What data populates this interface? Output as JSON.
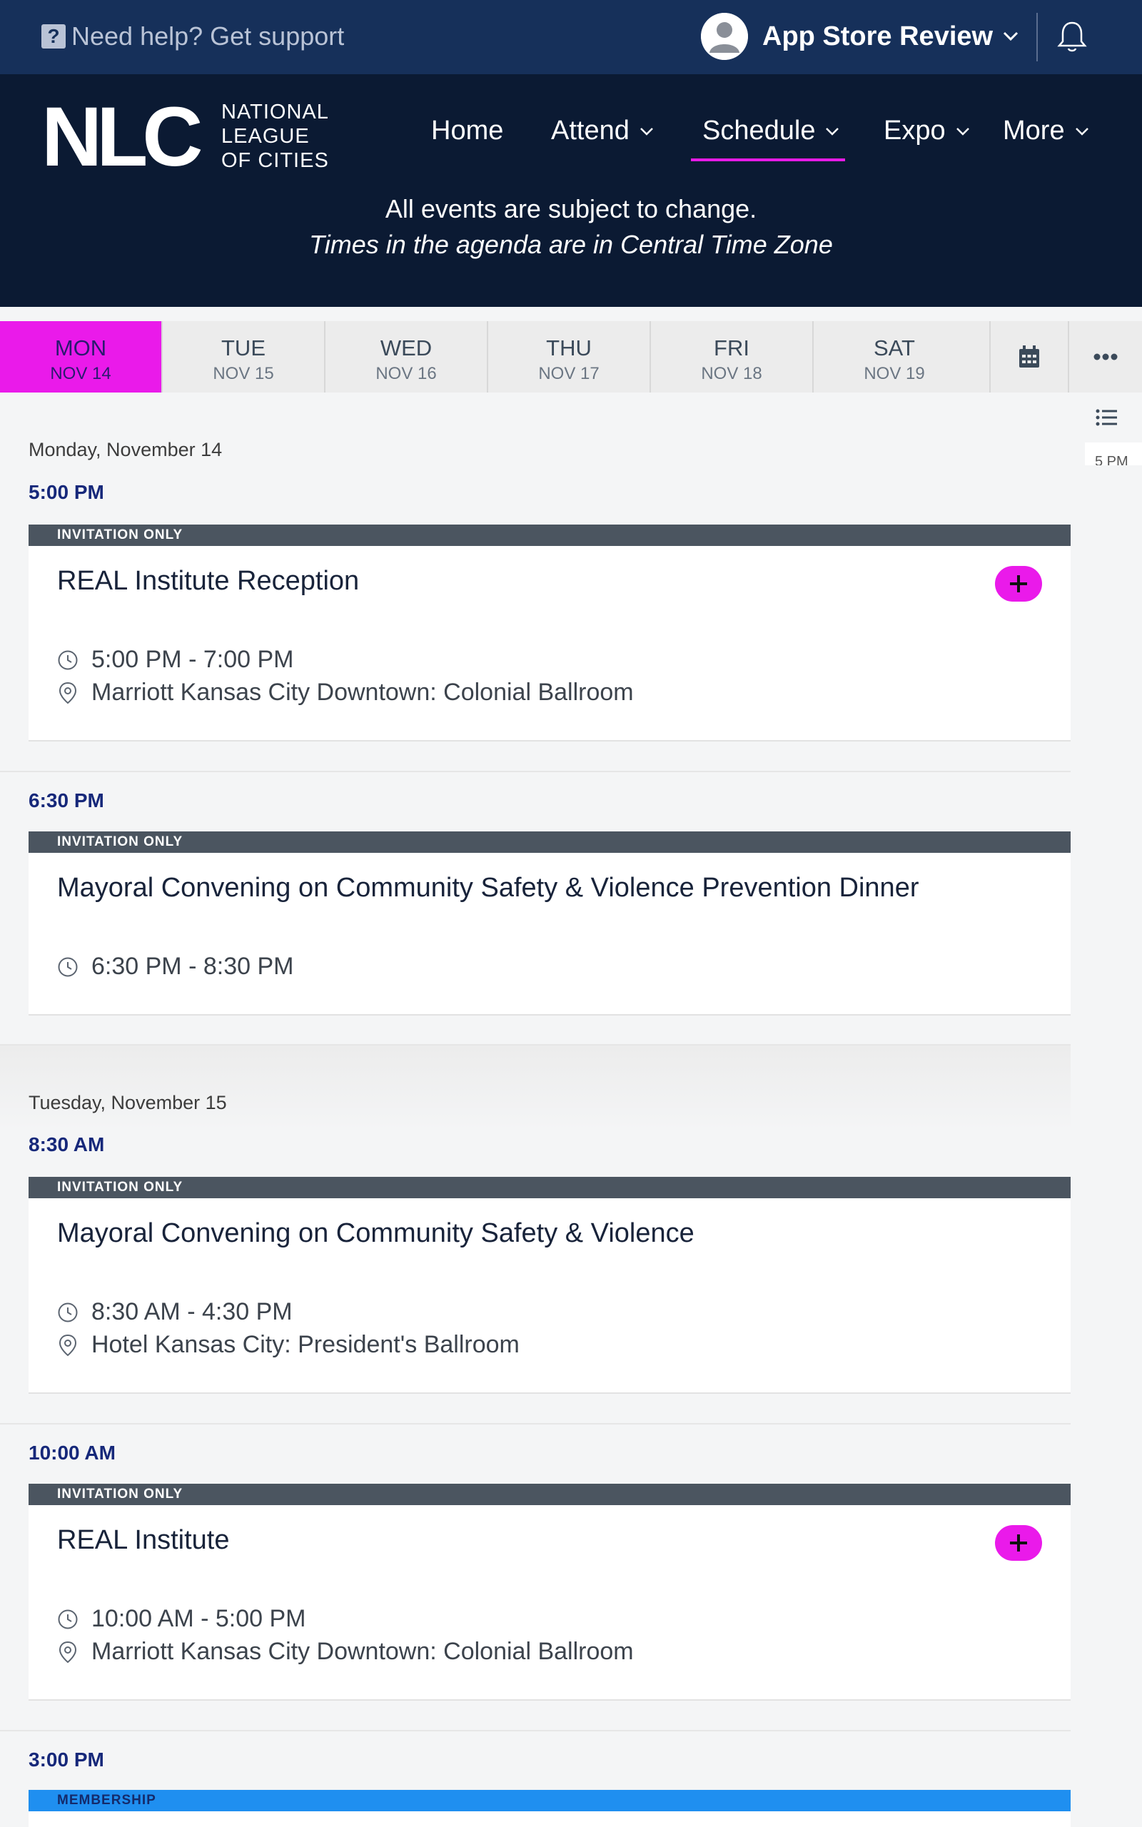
{
  "topbar": {
    "help_text": "Need help? Get support",
    "user_name": "App Store Review"
  },
  "brand": {
    "mark": "NLC",
    "line1": "NATIONAL",
    "line2": "LEAGUE",
    "line3": "OF CITIES"
  },
  "nav": {
    "home": "Home",
    "attend": "Attend",
    "schedule": "Schedule",
    "expo": "Expo",
    "more": "More"
  },
  "notice": {
    "line1": "All events are subject to change.",
    "line2": "Times in the agenda are in Central Time Zone"
  },
  "days": [
    {
      "name": "MON",
      "date": "NOV 14"
    },
    {
      "name": "TUE",
      "date": "NOV 15"
    },
    {
      "name": "WED",
      "date": "NOV 16"
    },
    {
      "name": "THU",
      "date": "NOV 17"
    },
    {
      "name": "FRI",
      "date": "NOV 18"
    },
    {
      "name": "SAT",
      "date": "NOV 19"
    }
  ],
  "side_time": "5 PM",
  "schedule": {
    "day1": "Monday, November 14",
    "day2": "Tuesday, November 15",
    "t1": "5:00 PM",
    "t2": "6:30 PM",
    "t3": "8:30 AM",
    "t4": "10:00 AM",
    "t5": "3:00 PM",
    "events": [
      {
        "badge": "INVITATION ONLY",
        "title": "REAL Institute Reception",
        "time": "5:00 PM - 7:00 PM",
        "location": "Marriott Kansas City Downtown: Colonial Ballroom"
      },
      {
        "badge": "INVITATION ONLY",
        "title": "Mayoral Convening on Community Safety & Violence Prevention Dinner",
        "time": "6:30 PM - 8:30 PM"
      },
      {
        "badge": "INVITATION ONLY",
        "title": "Mayoral Convening on Community Safety & Violence",
        "time": "8:30 AM - 4:30 PM",
        "location": "Hotel Kansas City: President's Ballroom"
      },
      {
        "badge": "INVITATION ONLY",
        "title": "REAL Institute",
        "time": "10:00 AM - 5:00 PM",
        "location": "Marriott Kansas City Downtown: Colonial Ballroom"
      },
      {
        "badge": "MEMBERSHIP"
      }
    ]
  },
  "colors": {
    "accent": "#ea1aea",
    "header_dark": "#0b1a33",
    "topbar": "#16305a",
    "time_blue": "#16287a",
    "membership_blue": "#1f8ff0"
  }
}
